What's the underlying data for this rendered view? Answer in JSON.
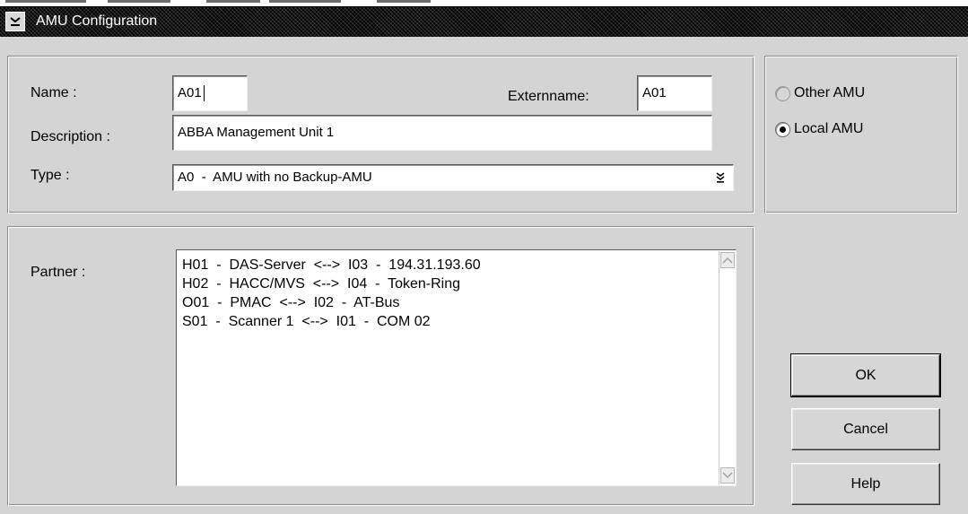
{
  "window": {
    "title": "AMU Configuration"
  },
  "form": {
    "name_label": "Name :",
    "name_value": "A01",
    "externname_label": "Externname:",
    "externname_value": "A01",
    "description_label": "Description :",
    "description_value": "ABBA Management Unit 1",
    "type_label": "Type :",
    "type_value": "A0  -  AMU with no Backup-AMU"
  },
  "amu_location": {
    "options": [
      {
        "label": "Other AMU",
        "selected": false
      },
      {
        "label": "Local AMU",
        "selected": true
      }
    ]
  },
  "partner": {
    "label": "Partner :",
    "items": [
      "H01  -  DAS-Server  <-->  I03  -  194.31.193.60",
      "H02  -  HACC/MVS  <-->  I04  -  Token-Ring",
      "O01  -  PMAC  <-->  I02  -  AT-Bus",
      "S01  -  Scanner 1  <-->  I01  -  COM 02"
    ]
  },
  "buttons": {
    "ok": "OK",
    "cancel": "Cancel",
    "help": "Help"
  },
  "icons": {
    "system_menu": "minimize-bar-icon",
    "dropdown": "double-chevron-down-icon",
    "scroll_up": "triangle-up-icon",
    "scroll_down": "triangle-down-icon"
  }
}
